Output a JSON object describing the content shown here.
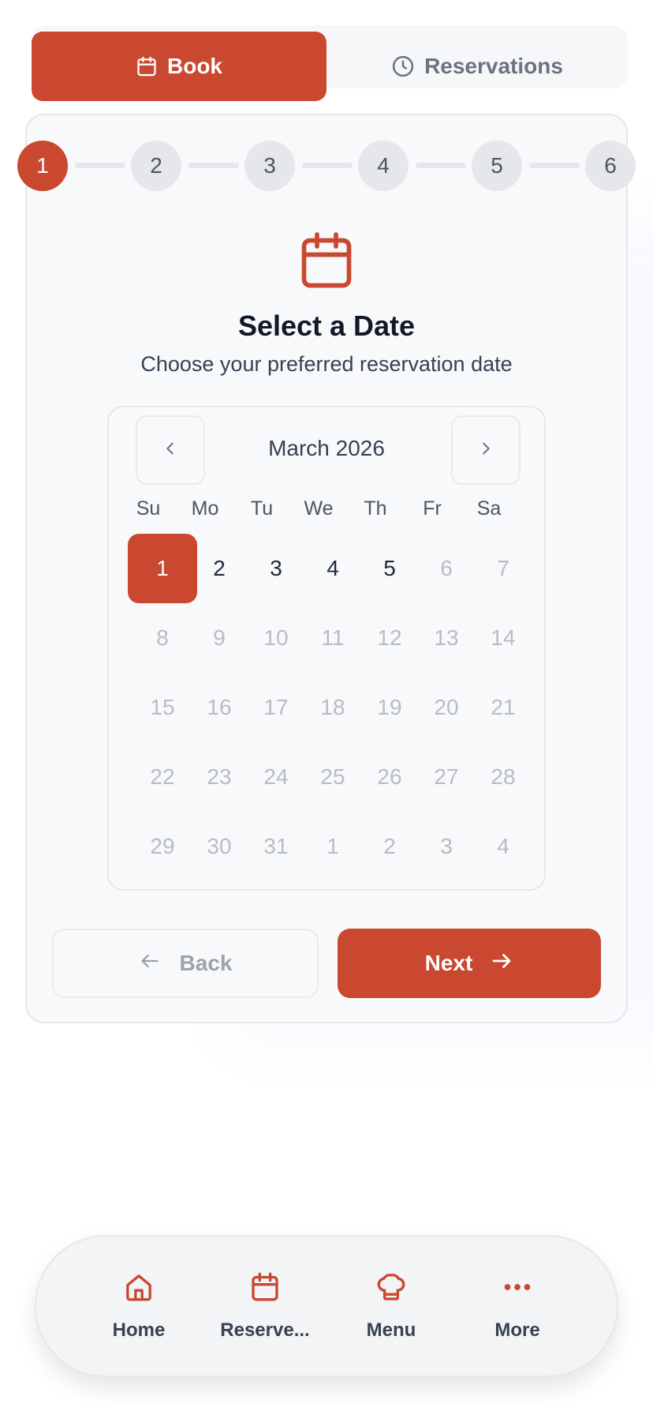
{
  "tabs": [
    {
      "label": "Book",
      "icon": "calendar-icon",
      "active": true
    },
    {
      "label": "Reservations",
      "icon": "clock-icon",
      "active": false
    }
  ],
  "stepper": {
    "steps": [
      "1",
      "2",
      "3",
      "4",
      "5",
      "6"
    ],
    "current": 1
  },
  "header": {
    "icon": "calendar-icon",
    "title": "Select a Date",
    "subtitle": "Choose your preferred reservation date"
  },
  "calendar": {
    "month_label": "March 2026",
    "weekdays": [
      "Su",
      "Mo",
      "Tu",
      "We",
      "Th",
      "Fr",
      "Sa"
    ],
    "weeks": [
      [
        "1",
        "2",
        "3",
        "4",
        "5",
        "6",
        "7"
      ],
      [
        "8",
        "9",
        "10",
        "11",
        "12",
        "13",
        "14"
      ],
      [
        "15",
        "16",
        "17",
        "18",
        "19",
        "20",
        "21"
      ],
      [
        "22",
        "23",
        "24",
        "25",
        "26",
        "27",
        "28"
      ],
      [
        "29",
        "30",
        "31",
        "1",
        "2",
        "3",
        "4"
      ]
    ],
    "selected": "1",
    "enabled_days": [
      "1",
      "2",
      "3",
      "4",
      "5"
    ]
  },
  "actions": {
    "back_label": "Back",
    "next_label": "Next"
  },
  "bottom_nav": [
    {
      "label": "Home",
      "icon": "home-icon"
    },
    {
      "label": "Reserve...",
      "icon": "calendar-icon"
    },
    {
      "label": "Menu",
      "icon": "chef-hat-icon"
    },
    {
      "label": "More",
      "icon": "more-dots-icon"
    }
  ],
  "colors": {
    "accent": "#c9482f",
    "muted": "#b8bcc3",
    "border": "#e5e7eb"
  }
}
